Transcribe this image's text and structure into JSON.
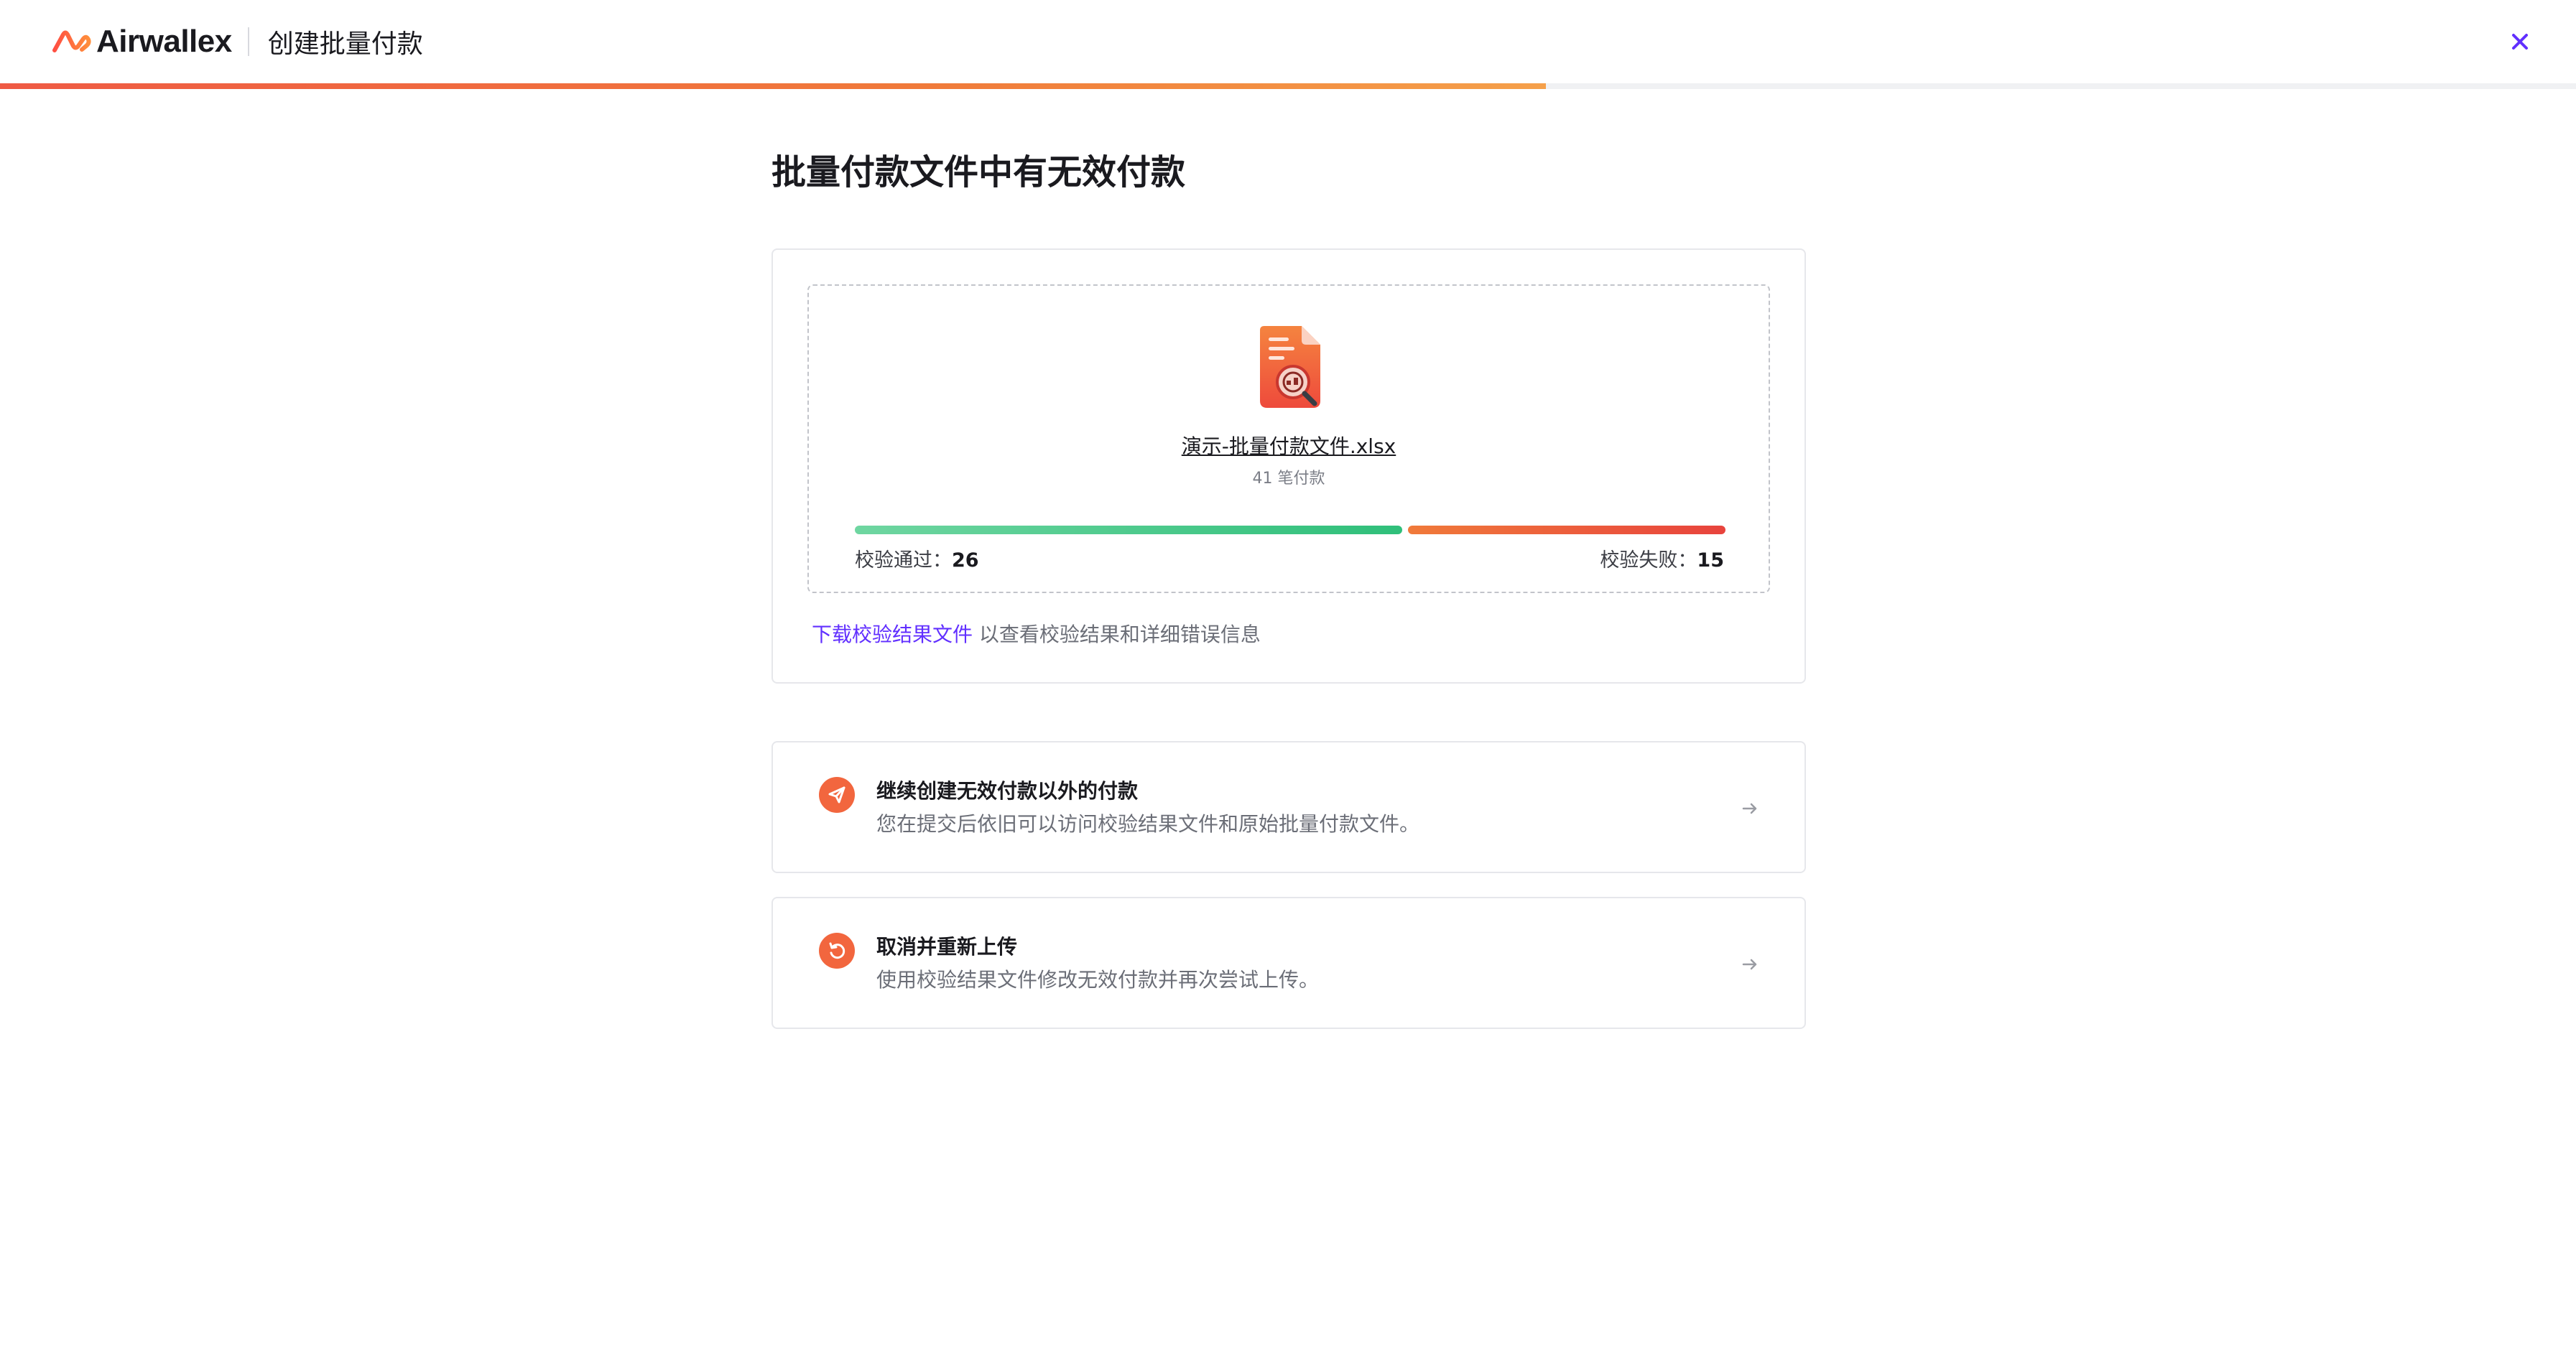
{
  "header": {
    "brand_name": "Airwallex",
    "title": "创建批量付款",
    "close_icon": "close-icon",
    "step_progress": 0.6
  },
  "main": {
    "title": "批量付款文件中有无效付款"
  },
  "file_card": {
    "file_icon": "spreadsheet-search-icon",
    "file_name": "演示-批量付款文件.xlsx",
    "payment_count": "41 笔付款",
    "pass_label": "校验通过：",
    "pass_count": "26",
    "fail_label": "校验失败：",
    "fail_count": "15",
    "download_link": "下载校验结果文件",
    "download_hint": " 以查看校验结果和详细错误信息"
  },
  "options": [
    {
      "icon": "send-icon",
      "title": "继续创建无效付款以外的付款",
      "desc": "您在提交后依旧可以访问校验结果文件和原始批量付款文件。",
      "arrow": "arrow-right-icon"
    },
    {
      "icon": "retry-icon",
      "title": "取消并重新上传",
      "desc": "使用校验结果文件修改无效付款并再次尝试上传。",
      "arrow": "arrow-right-icon"
    }
  ],
  "colors": {
    "accent": "#612fff",
    "brand_orange": "#f2663e",
    "pass_green": "#2fbf7a",
    "fail_red": "#e8433d"
  }
}
